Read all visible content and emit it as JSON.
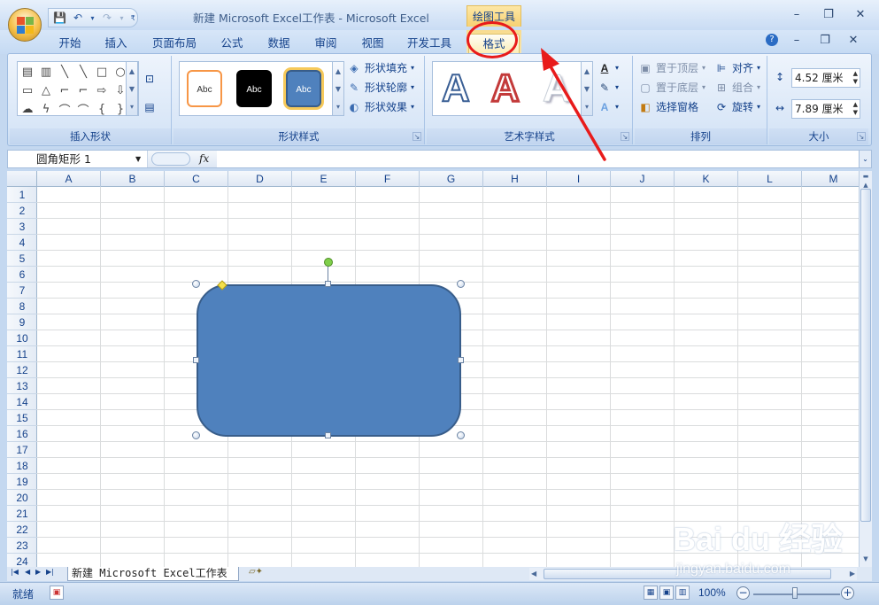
{
  "window": {
    "title": "新建 Microsoft Excel工作表 - Microsoft Excel",
    "context_group": "绘图工具",
    "controls": [
      "–",
      "❐",
      "✕"
    ],
    "ribbon_controls": [
      "?",
      "–",
      "❐",
      "✕"
    ]
  },
  "qat": {
    "save_icon": "💾",
    "undo_icon": "↶",
    "redo_icon": "↷",
    "dropdown_icon": "▾",
    "customize_icon": "₹"
  },
  "tabs": [
    {
      "label": "开始"
    },
    {
      "label": "插入"
    },
    {
      "label": "页面布局"
    },
    {
      "label": "公式"
    },
    {
      "label": "数据"
    },
    {
      "label": "审阅"
    },
    {
      "label": "视图"
    },
    {
      "label": "开发工具"
    },
    {
      "label": "格式",
      "selected": true
    }
  ],
  "ribbon": {
    "insert_shapes": {
      "label": "插入形状",
      "shapes": [
        "▤",
        "▥",
        "╲",
        "╲",
        "□",
        "○",
        "▭",
        "△",
        "⌐",
        "⌐",
        "⇨",
        "⇩",
        "☁",
        "ϟ",
        "⌒",
        "⌒",
        "{",
        "}"
      ],
      "edit_icon": "⊡",
      "textbox_icon": "▤"
    },
    "shape_styles": {
      "label": "形状样式",
      "swatches": [
        {
          "text": "Abc",
          "fill": "#ffffff",
          "border": "#f79646",
          "color": "#333333"
        },
        {
          "text": "Abc",
          "fill": "#000000",
          "border": "#000000",
          "color": "#ffffff"
        },
        {
          "text": "Abc",
          "fill": "#4f81bd",
          "border": "#385d8a",
          "color": "#ffffff"
        }
      ],
      "fill": "形状填充",
      "outline": "形状轮廓",
      "effects": "形状效果"
    },
    "wordart": {
      "label": "艺术字样式",
      "letters": [
        "A",
        "A",
        "A"
      ]
    },
    "arrange": {
      "label": "排列",
      "bring_front": "置于顶层",
      "send_back": "置于底层",
      "selection_pane": "选择窗格",
      "align": "对齐",
      "group": "组合",
      "rotate": "旋转"
    },
    "size": {
      "label": "大小",
      "height": "4.52 厘米",
      "width": "7.89 厘米"
    }
  },
  "formula_bar": {
    "name_box": "圆角矩形 1",
    "fx": "fx",
    "content": ""
  },
  "sheet": {
    "columns": [
      "A",
      "B",
      "C",
      "D",
      "E",
      "F",
      "G",
      "H",
      "I",
      "J",
      "K",
      "L",
      "M"
    ],
    "rows": [
      "1",
      "2",
      "3",
      "4",
      "5",
      "6",
      "7",
      "8",
      "9",
      "10",
      "11",
      "12",
      "13",
      "14",
      "15",
      "16",
      "17",
      "18",
      "19",
      "20",
      "21",
      "22",
      "23",
      "24"
    ],
    "shape_name": "圆角矩形 1",
    "shape_fill": "#4f81bd",
    "tab": "新建 Microsoft Excel工作表"
  },
  "status": {
    "ready": "就绪",
    "zoom": "100%",
    "zoom_minus": "−",
    "zoom_plus": "+"
  },
  "watermark": {
    "brand": "Bai du 经验",
    "url": "jingyan.baidu.com"
  },
  "colors": {
    "accent": "#15428b",
    "callout": "#e81b1b"
  }
}
